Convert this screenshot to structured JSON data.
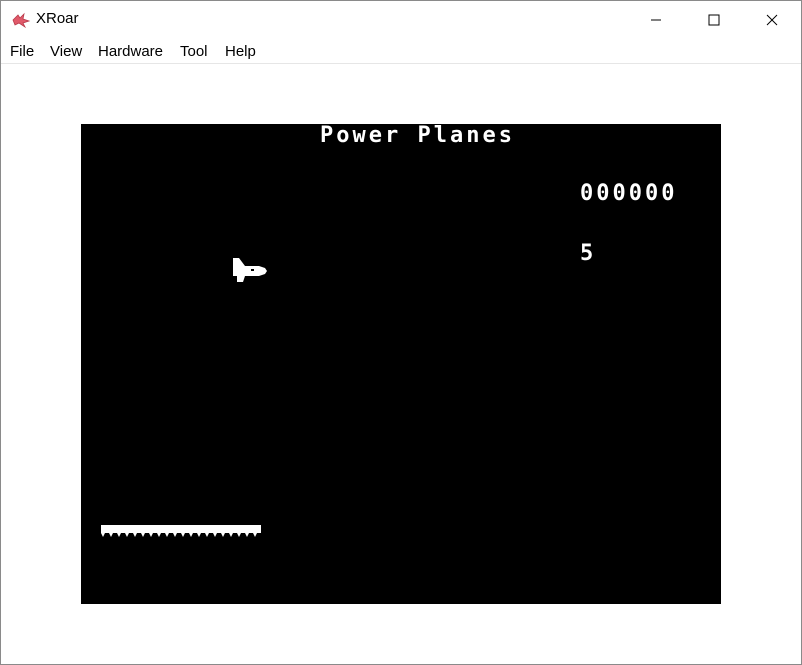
{
  "window": {
    "title": "XRoar",
    "icon": "xroar-dragon-icon",
    "controls": [
      "minimize-icon",
      "maximize-icon",
      "close-icon"
    ]
  },
  "menu": [
    "File",
    "View",
    "Hardware",
    "Tool",
    "Help"
  ],
  "game": {
    "title": "Power Planes",
    "score": "000000",
    "lives": "5",
    "colors": {
      "background": "#000000",
      "foreground": "#ffffff"
    }
  }
}
